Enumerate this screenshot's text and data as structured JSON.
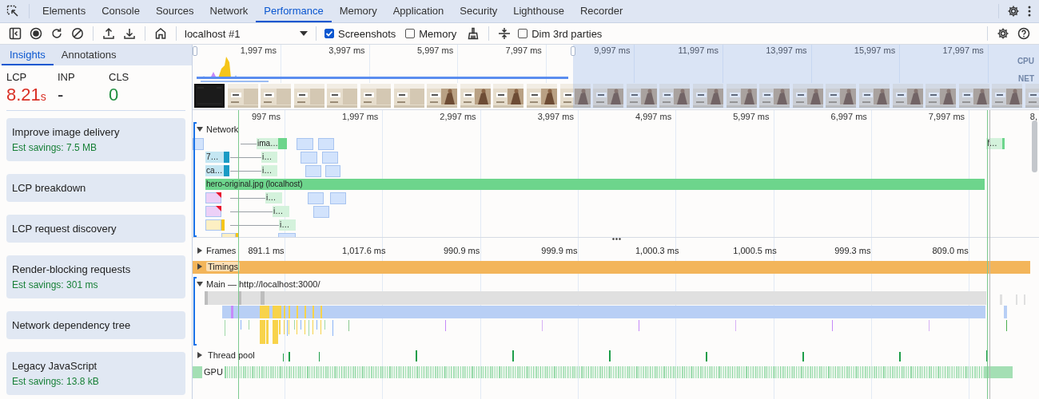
{
  "devtools_tabs": [
    {
      "label": "Elements",
      "selected": false
    },
    {
      "label": "Console",
      "selected": false
    },
    {
      "label": "Sources",
      "selected": false
    },
    {
      "label": "Network",
      "selected": false
    },
    {
      "label": "Performance",
      "selected": true
    },
    {
      "label": "Memory",
      "selected": false
    },
    {
      "label": "Application",
      "selected": false
    },
    {
      "label": "Security",
      "selected": false
    },
    {
      "label": "Lighthouse",
      "selected": false
    },
    {
      "label": "Recorder",
      "selected": false
    }
  ],
  "toolbar": {
    "target": "localhost #1",
    "checkboxes": [
      {
        "label": "Screenshots",
        "checked": true
      },
      {
        "label": "Memory",
        "checked": false
      }
    ],
    "dim_third_parties": {
      "label": "Dim 3rd parties",
      "checked": false
    }
  },
  "sidebar": {
    "tabs": [
      {
        "label": "Insights",
        "selected": true
      },
      {
        "label": "Annotations",
        "selected": false
      }
    ],
    "metrics": [
      {
        "name": "LCP",
        "value": "8.21",
        "unit": "s",
        "color": "#d93025"
      },
      {
        "name": "INP",
        "value": "-",
        "color": "#202124"
      },
      {
        "name": "CLS",
        "value": "0",
        "color": "#1e8e3e"
      }
    ],
    "insights": [
      {
        "title": "Improve image delivery",
        "savings": "Est savings: 7.5 MB"
      },
      {
        "title": "LCP breakdown"
      },
      {
        "title": "LCP request discovery"
      },
      {
        "title": "Render-blocking requests",
        "savings": "Est savings: 301 ms"
      },
      {
        "title": "Network dependency tree"
      },
      {
        "title": "Legacy JavaScript",
        "savings": "Est savings: 13.8 kB"
      }
    ]
  },
  "overview": {
    "ticks": [
      "1,997 ms",
      "3,997 ms",
      "5,997 ms",
      "7,997 ms",
      "9,997 ms",
      "11,997 ms",
      "13,997 ms",
      "15,997 ms",
      "17,997 ms"
    ],
    "tracks": [
      "CPU",
      "NET"
    ],
    "screenshots": [
      {
        "kind": "blank"
      },
      {
        "kind": "picture"
      },
      {
        "kind": "picture"
      },
      {
        "kind": "picture"
      },
      {
        "kind": "picture"
      },
      {
        "kind": "picture"
      },
      {
        "kind": "picture"
      },
      {
        "kind": "picture"
      },
      {
        "kind": "picture"
      },
      {
        "kind": "picture"
      },
      {
        "kind": "picture"
      },
      {
        "kind": "picture"
      },
      {
        "kind": "picture"
      },
      {
        "kind": "picture"
      },
      {
        "kind": "picture"
      },
      {
        "kind": "picture"
      },
      {
        "kind": "picture"
      },
      {
        "kind": "picture"
      },
      {
        "kind": "picture"
      },
      {
        "kind": "picture"
      },
      {
        "kind": "picture"
      },
      {
        "kind": "picture"
      },
      {
        "kind": "picture"
      },
      {
        "kind": "picture"
      },
      {
        "kind": "picture"
      },
      {
        "kind": "picture"
      }
    ]
  },
  "timeline": {
    "ticks": [
      "997 ms",
      "1,997 ms",
      "2,997 ms",
      "3,997 ms",
      "4,997 ms",
      "5,997 ms",
      "6,997 ms",
      "7,997 ms",
      "8,"
    ],
    "network": {
      "title": "Network",
      "expanded": true,
      "rows": [
        {
          "requests": [
            {
              "color": "#d2e3fc"
            },
            {
              "label": "ima…",
              "color": "#d4f2dc",
              "tail": {
                "color": "#6dd58c"
              }
            },
            {
              "color": "#d2e3fc"
            },
            {
              "color": "#d2e3fc"
            },
            {
              "label": "f…",
              "color": "#d4f2dc",
              "tail": {
                "color": "#6dd58c"
              }
            }
          ]
        },
        {
          "requests": [
            {
              "label": "7…",
              "color": "#c4e6f2",
              "tail": {
                "color": "#1a9bc4"
              }
            },
            {
              "label": "i…",
              "color": "#d4f2dc"
            },
            {
              "color": "#d2e3fc"
            },
            {
              "color": "#d2e3fc"
            }
          ]
        },
        {
          "requests": [
            {
              "label": "ca…",
              "color": "#c4e6f2",
              "tail": {
                "color": "#1a9bc4"
              }
            },
            {
              "label": "i…",
              "color": "#d4f2dc"
            },
            {
              "color": "#d2e3fc"
            },
            {
              "color": "#d2e3fc"
            }
          ]
        },
        {
          "requests": [
            {
              "label": "hero-original.jpg (localhost)",
              "color": "#6dd58c"
            }
          ]
        },
        {
          "requests": [
            {
              "color": "#ecd0f7",
              "render_blocking": true
            },
            {
              "label": "i…",
              "color": "#d4f2dc"
            },
            {
              "color": "#d2e3fc"
            },
            {
              "color": "#d2e3fc"
            }
          ]
        },
        {
          "requests": [
            {
              "color": "#ecd0f7",
              "render_blocking": true
            },
            {
              "label": "i…",
              "color": "#d4f2dc"
            },
            {
              "color": "#d2e3fc"
            }
          ]
        },
        {
          "requests": [
            {
              "color": "#fdefc3",
              "tail": {
                "color": "#f5c518"
              }
            },
            {
              "label": "i…",
              "color": "#d4f2dc"
            }
          ]
        },
        {
          "requests": [
            {
              "color": "#fdefc3",
              "tail": {
                "color": "#f5c518"
              }
            },
            {
              "color": "#d2e3fc"
            }
          ]
        }
      ]
    },
    "frames": {
      "title": "Frames",
      "expanded": false,
      "durations": [
        "891.1 ms",
        "1,017.6 ms",
        "990.9 ms",
        "999.9 ms",
        "1,000.3 ms",
        "1,000.5 ms",
        "999.3 ms",
        "809.0 ms"
      ]
    },
    "timings": {
      "title": "Timings",
      "expanded": false
    },
    "main": {
      "title": "Main — http://localhost:3000/",
      "expanded": true
    },
    "thread_pool": {
      "title": "Thread pool",
      "expanded": false
    },
    "gpu": {
      "title": "GPU"
    }
  }
}
